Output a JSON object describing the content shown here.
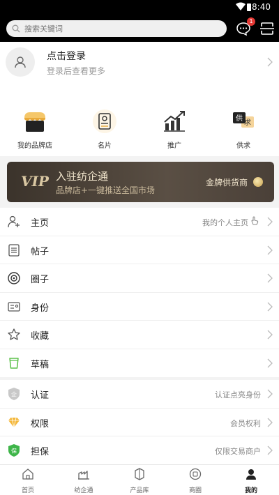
{
  "status": {
    "time": "8:40"
  },
  "header": {
    "search_placeholder": "搜索关键词",
    "message_badge": "1"
  },
  "profile": {
    "title": "点击登录",
    "subtitle": "登录后查看更多"
  },
  "shortcuts": [
    {
      "label": "我的品牌店",
      "icon": "shop-icon"
    },
    {
      "label": "名片",
      "icon": "card-icon"
    },
    {
      "label": "推广",
      "icon": "chart-icon"
    },
    {
      "label": "供求",
      "icon": "supply-demand-icon"
    }
  ],
  "vip": {
    "mark": "VIP",
    "title": "入驻纺企通",
    "subtitle": "品牌店+一键推送全国市场",
    "gold_label": "金牌供货商"
  },
  "menu_group1": [
    {
      "label": "主页",
      "value": "我的个人主页",
      "icon": "user-add-icon"
    },
    {
      "label": "帖子",
      "value": "",
      "icon": "post-icon"
    },
    {
      "label": "圈子",
      "value": "",
      "icon": "circle-icon"
    },
    {
      "label": "身份",
      "value": "",
      "icon": "id-card-icon"
    },
    {
      "label": "收藏",
      "value": "",
      "icon": "star-icon"
    },
    {
      "label": "草稿",
      "value": "",
      "icon": "draft-icon"
    }
  ],
  "menu_group2": [
    {
      "label": "认证",
      "value": "认证点亮身份",
      "icon": "cert-shield-icon"
    },
    {
      "label": "权限",
      "value": "会员权利",
      "icon": "diamond-icon"
    },
    {
      "label": "担保",
      "value": "仅限交易商户",
      "icon": "guarantee-shield-icon"
    }
  ],
  "tabs": [
    {
      "label": "首页",
      "icon": "home-icon"
    },
    {
      "label": "纺企通",
      "icon": "factory-icon"
    },
    {
      "label": "产品库",
      "icon": "product-icon"
    },
    {
      "label": "商圈",
      "icon": "business-circle-icon"
    },
    {
      "label": "我的",
      "icon": "profile-icon",
      "active": true
    }
  ],
  "colors": {
    "vip_bg": "#3b332b",
    "vip_text": "#f4e8cf",
    "badge": "#e53935"
  }
}
